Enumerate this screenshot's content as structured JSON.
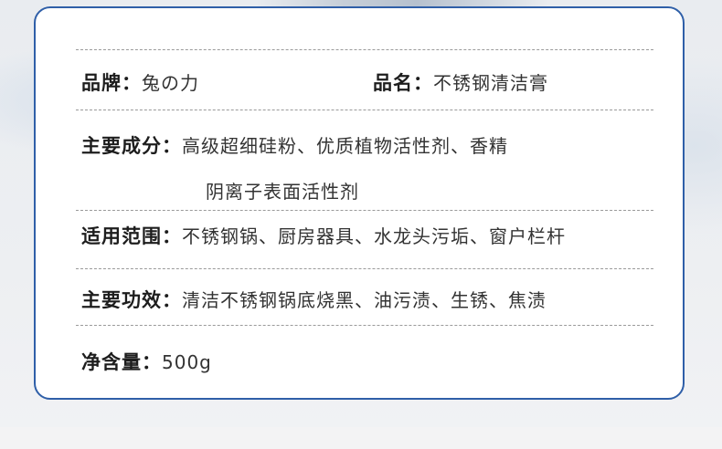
{
  "colors": {
    "card_border": "#2f5fa8",
    "label_text": "#1d1d1d",
    "value_text": "#333333",
    "divider": "#9a9a9a"
  },
  "brand": {
    "label": "品牌：",
    "value": "兔の力"
  },
  "product_name": {
    "label": "品名：",
    "value": "不锈钢清洁膏"
  },
  "ingredients": {
    "label": "主要成分：",
    "line1": "高级超细硅粉、优质植物活性剂、香精",
    "line2": "阴离子表面活性剂"
  },
  "scope": {
    "label": "适用范围：",
    "value": "不锈钢锅、厨房器具、水龙头污垢、窗户栏杆"
  },
  "effect": {
    "label": "主要功效：",
    "value": "清洁不锈钢锅底烧黑、油污渍、生锈、焦渍"
  },
  "net_content": {
    "label": "净含量：",
    "value": "500g"
  }
}
